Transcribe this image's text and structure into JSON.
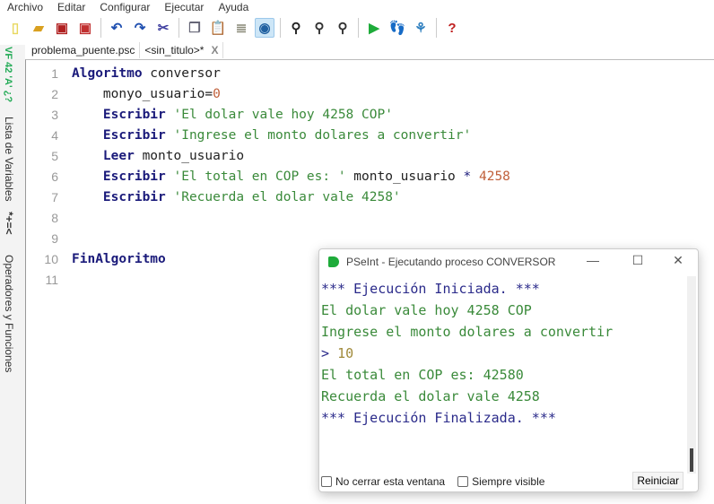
{
  "menu": [
    "Archivo",
    "Editar",
    "Configurar",
    "Ejecutar",
    "Ayuda"
  ],
  "toolbar": [
    {
      "icon": "new-file-icon",
      "glyph": "▯",
      "color": "#e8d860"
    },
    {
      "icon": "open-folder-icon",
      "glyph": "▰",
      "color": "#d9a020"
    },
    {
      "icon": "save-icon",
      "glyph": "▣",
      "color": "#b02020"
    },
    {
      "icon": "save-as-icon",
      "glyph": "▣",
      "color": "#c03030"
    },
    {
      "icon": "undo-icon",
      "glyph": "↶",
      "color": "#2050b0"
    },
    {
      "icon": "redo-icon",
      "glyph": "↷",
      "color": "#2050b0"
    },
    {
      "icon": "cut-icon",
      "glyph": "✂",
      "color": "#4040a0"
    },
    {
      "icon": "copy-icon",
      "glyph": "❐",
      "color": "#667"
    },
    {
      "icon": "paste-icon",
      "glyph": "📋",
      "color": "#a06020"
    },
    {
      "icon": "edit-icon",
      "glyph": "≣",
      "color": "#887"
    },
    {
      "icon": "indent-icon",
      "glyph": "◉",
      "color": "#2060a0"
    },
    {
      "icon": "find-icon",
      "glyph": "⚲",
      "color": "#222"
    },
    {
      "icon": "find-previous-icon",
      "glyph": "⚲",
      "color": "#333"
    },
    {
      "icon": "find-next-icon",
      "glyph": "⚲",
      "color": "#333"
    },
    {
      "icon": "run-icon",
      "glyph": "▶",
      "color": "#1eab3a"
    },
    {
      "icon": "step-by-step-icon",
      "glyph": "👣",
      "color": "#c07050"
    },
    {
      "icon": "flowchart-icon",
      "glyph": "⚘",
      "color": "#3080c0"
    },
    {
      "icon": "help-icon",
      "glyph": "?",
      "color": "#c02020"
    }
  ],
  "tabs": [
    {
      "label": "problema_puente.psc"
    },
    {
      "label": "<sin_titulo>*",
      "close": "X"
    }
  ],
  "side": {
    "vars_icon": "VF 42 'A' ¿?",
    "vars_label": "Lista de Variables",
    "ops_icon": "*+=<",
    "ops_label": "Operadores y Funciones"
  },
  "code": [
    {
      "n": "1",
      "tokens": [
        [
          "kw",
          "Algoritmo"
        ],
        [
          "id",
          " conversor"
        ]
      ]
    },
    {
      "n": "2",
      "tokens": [
        [
          "id",
          "    monyo_usuario="
        ],
        [
          "num",
          "0"
        ]
      ]
    },
    {
      "n": "3",
      "tokens": [
        [
          "kw",
          "    Escribir"
        ],
        [
          "str",
          " 'El dolar vale hoy 4258 COP'"
        ]
      ]
    },
    {
      "n": "4",
      "tokens": [
        [
          "kw",
          "    Escribir"
        ],
        [
          "str",
          " 'Ingrese el monto dolares a convertir'"
        ]
      ]
    },
    {
      "n": "5",
      "tokens": [
        [
          "kw",
          "    Leer"
        ],
        [
          "id",
          " monto_usuario"
        ]
      ]
    },
    {
      "n": "6",
      "tokens": [
        [
          "kw",
          "    Escribir"
        ],
        [
          "str",
          " 'El total en COP es: '"
        ],
        [
          "id",
          " monto_usuario "
        ],
        [
          "op",
          "*"
        ],
        [
          "num",
          " 4258"
        ]
      ]
    },
    {
      "n": "7",
      "tokens": [
        [
          "kw",
          "    Escribir"
        ],
        [
          "str",
          " 'Recuerda el dolar vale 4258'"
        ]
      ]
    },
    {
      "n": "8",
      "tokens": []
    },
    {
      "n": "9",
      "tokens": []
    },
    {
      "n": "10",
      "tokens": [
        [
          "kw",
          "FinAlgoritmo"
        ]
      ]
    },
    {
      "n": "11",
      "tokens": []
    }
  ],
  "console": {
    "title": "PSeInt - Ejecutando proceso CONVERSOR",
    "lines": [
      [
        "sys",
        "*** Ejecución Iniciada. ***"
      ],
      [
        "out",
        "El dolar vale hoy 4258 COP"
      ],
      [
        "out",
        "Ingrese el monto dolares a convertir"
      ],
      [
        "mix",
        "> ",
        "10"
      ],
      [
        "out",
        "El total en COP es: 42580"
      ],
      [
        "out",
        "Recuerda el dolar vale 4258"
      ],
      [
        "sys",
        "*** Ejecución Finalizada. ***"
      ]
    ],
    "no_cerrar": "No cerrar esta ventana",
    "siempre_visible": "Siempre visible",
    "reiniciar": "Reiniciar",
    "minimize": "—",
    "maximize": "☐",
    "close": "✕"
  }
}
